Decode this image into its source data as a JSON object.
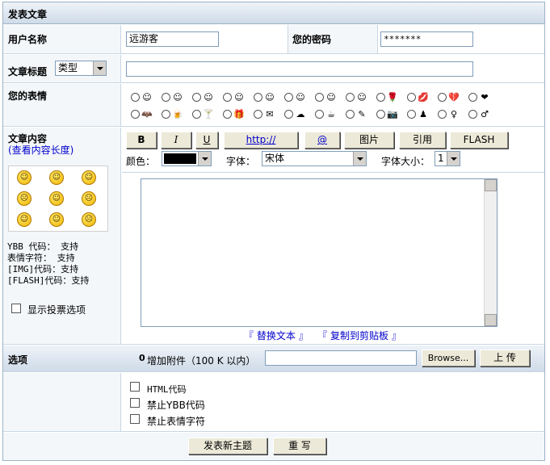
{
  "header": {
    "title": "发表文章"
  },
  "user": {
    "label": "用户名称",
    "value": "远游客",
    "password_label": "您的密码",
    "password_value": "*******"
  },
  "subject": {
    "label": "文章标题",
    "type_select": "类型",
    "value": ""
  },
  "emotion": {
    "label": "您的表情",
    "row1": [
      "☺",
      "☺",
      "☺",
      "☺",
      "☺",
      "☺",
      "☺",
      "☺",
      "🌹",
      "💋",
      "💔",
      "❤"
    ],
    "row2": [
      "🦇",
      "🍺",
      "🍸",
      "🎁",
      "✉",
      "☁",
      "☕",
      "✎",
      "📷",
      "♟",
      "♀",
      "♂"
    ]
  },
  "content": {
    "label": "文章内容",
    "length_link": "(查看内容长度)",
    "faces": [
      "☺",
      "☺",
      "☺",
      "☹",
      "☺",
      "☹",
      "☺",
      "☺",
      "☹"
    ],
    "codes": [
      "YBB 代码： 支持",
      "表情字符： 支持",
      "[IMG]代码：支持",
      "[FLASH]代码：支持"
    ],
    "vote_label": "显示投票选项",
    "toolbar": {
      "bold": "B",
      "italic": "I",
      "underline": "U",
      "http": "http://",
      "at": "@",
      "image": "图片",
      "quote": "引用",
      "flash": "FLASH"
    },
    "color_label": "颜色：",
    "color_value": "#000000",
    "font_label": "字体：",
    "font_value": "宋体",
    "size_label": "字体大小：",
    "size_value": "1",
    "replace_link": "替换文本",
    "copy_link": "复制到剪贴板",
    "bracket_l": "『",
    "bracket_r": "』"
  },
  "options": {
    "label": "选项",
    "attach_icon": "0",
    "attach_label": "增加附件（100 K 以内）",
    "browse": "Browse...",
    "upload": "上 传",
    "html_code": "HTML代码",
    "no_ybb": "禁止YBB代码",
    "no_emoticon": "禁止表情字符"
  },
  "footer": {
    "submit": "发表新主题",
    "reset": "重 写"
  }
}
